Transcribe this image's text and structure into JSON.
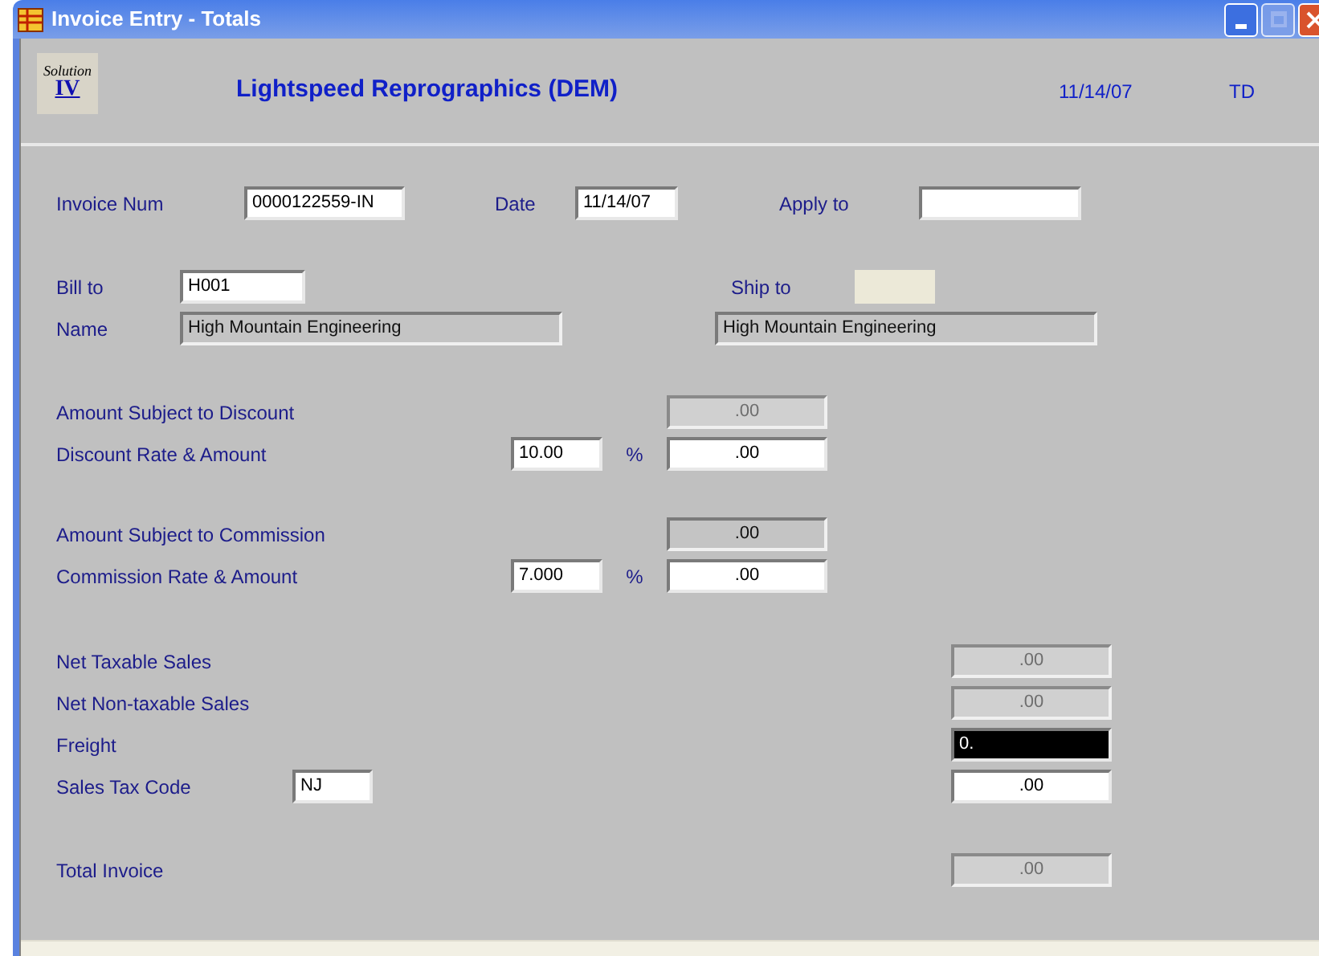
{
  "window": {
    "title": "Invoice Entry - Totals",
    "controls": [
      {
        "kind": "minimize",
        "disabled": false
      },
      {
        "kind": "maximize",
        "disabled": true
      },
      {
        "kind": "close",
        "disabled": false
      }
    ]
  },
  "header": {
    "logo_top": "Solution",
    "logo_bottom": "IV",
    "company": "Lightspeed Reprographics (DEM)",
    "date": "11/14/07",
    "user": "TD"
  },
  "invoice_row": {
    "invoice_num": {
      "label": "Invoice Num",
      "value": "0000122559-IN",
      "kind": "input"
    },
    "date": {
      "label": "Date",
      "value": "11/14/07",
      "kind": "input"
    },
    "apply_to": {
      "label": "Apply to",
      "kind": "input"
    }
  },
  "bill_to": {
    "label": "Bill to",
    "value": "H001",
    "kind": "input"
  },
  "ship_to": {
    "label": "Ship to",
    "kind": "locked"
  },
  "name": {
    "label": "Name",
    "bill_value": "High Mountain Engineering",
    "ship_value": "High Mountain Engineering",
    "kind": "readonly"
  },
  "discount": {
    "subject_label": "Amount Subject to Discount",
    "subject": {
      "value": ".00",
      "kind": "disabled"
    },
    "rate_label": "Discount Rate & Amount",
    "rate": {
      "value": "10.00",
      "kind": "input"
    },
    "percent": "%",
    "amount": {
      "value": ".00",
      "kind": "input"
    }
  },
  "commission": {
    "subject_label": "Amount Subject to Commission",
    "subject": {
      "value": ".00",
      "kind": "readonly"
    },
    "rate_label": "Commission Rate & Amount",
    "rate": {
      "value": "7.000",
      "kind": "input"
    },
    "percent": "%",
    "amount": {
      "value": ".00",
      "kind": "input"
    }
  },
  "totals": [
    {
      "label": "Net Taxable Sales",
      "value": ".00",
      "kind": "disabled"
    },
    {
      "label": "Net Non-taxable Sales",
      "value": ".00",
      "kind": "disabled"
    },
    {
      "label": "Freight",
      "value": "0.",
      "kind": "focused"
    }
  ],
  "sales_tax": {
    "label": "Sales Tax Code",
    "code": {
      "value": "NJ",
      "kind": "input"
    },
    "amount": {
      "value": ".00",
      "kind": "input"
    }
  },
  "total_invoice": {
    "label": "Total Invoice",
    "value": ".00",
    "kind": "disabled"
  }
}
